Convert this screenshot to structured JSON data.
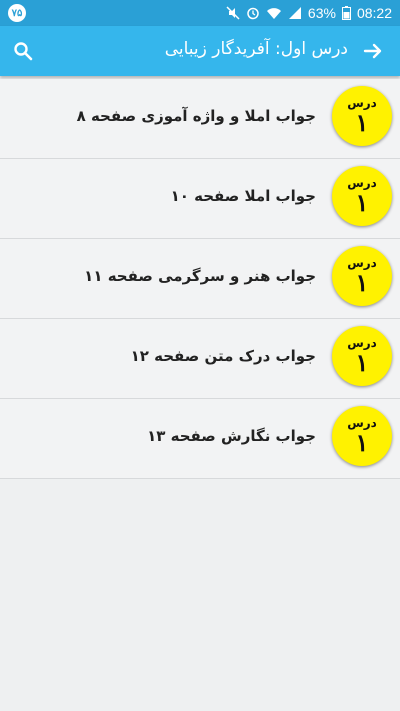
{
  "status_bar": {
    "badge": "۷۵",
    "battery": "63%",
    "time": "08:22"
  },
  "app_bar": {
    "title": "درس اول: آفریدگار زیبایی",
    "back_icon": "arrow-right-icon",
    "search_icon": "search-icon"
  },
  "items": [
    {
      "badge_title": "درس",
      "badge_number": "۱",
      "label": "جواب املا و واژه آموزی صفحه ۸"
    },
    {
      "badge_title": "درس",
      "badge_number": "۱",
      "label": "جواب املا صفحه ۱۰"
    },
    {
      "badge_title": "درس",
      "badge_number": "۱",
      "label": "جواب هنر و سرگرمی صفحه ۱۱"
    },
    {
      "badge_title": "درس",
      "badge_number": "۱",
      "label": "جواب درک متن صفحه ۱۲"
    },
    {
      "badge_title": "درس",
      "badge_number": "۱",
      "label": "جواب نگارش صفحه ۱۳"
    }
  ],
  "colors": {
    "status_bar": "#2aa0d6",
    "app_bar": "#35b6ec",
    "badge": "#fff200",
    "background": "#eef0f1"
  }
}
